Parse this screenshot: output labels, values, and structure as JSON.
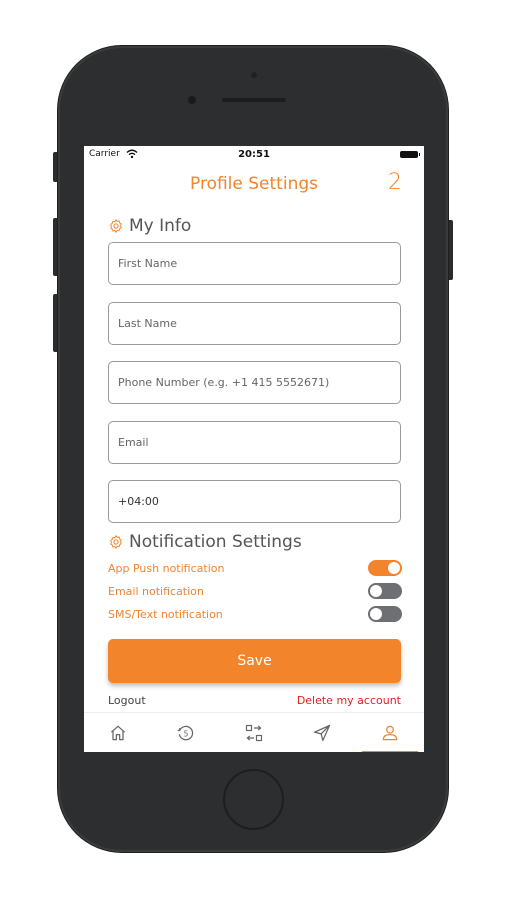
{
  "status_bar": {
    "carrier": "Carrier",
    "time": "20:51"
  },
  "header": {
    "title": "Profile Settings",
    "badge": "2"
  },
  "my_info": {
    "heading": "My Info",
    "fields": {
      "first_name_placeholder": "First Name",
      "last_name_placeholder": "Last Name",
      "phone_placeholder": "Phone Number (e.g. +1 415 5552671)",
      "email_placeholder": "Email",
      "timezone_value": "+04:00"
    }
  },
  "notifications": {
    "heading": "Notification Settings",
    "items": [
      {
        "label": "App Push notification",
        "enabled": true
      },
      {
        "label": "Email notification",
        "enabled": false
      },
      {
        "label": "SMS/Text notification",
        "enabled": false
      }
    ]
  },
  "actions": {
    "save_label": "Save",
    "logout_label": "Logout",
    "delete_label": "Delete my account"
  },
  "tabbar": {
    "tabs": [
      {
        "icon": "home-icon"
      },
      {
        "icon": "history-icon"
      },
      {
        "icon": "transfer-icon"
      },
      {
        "icon": "send-icon"
      },
      {
        "icon": "profile-icon",
        "active": true
      }
    ]
  },
  "colors": {
    "accent": "#f2842c",
    "danger": "#e02020",
    "device": "#2d2e30"
  }
}
